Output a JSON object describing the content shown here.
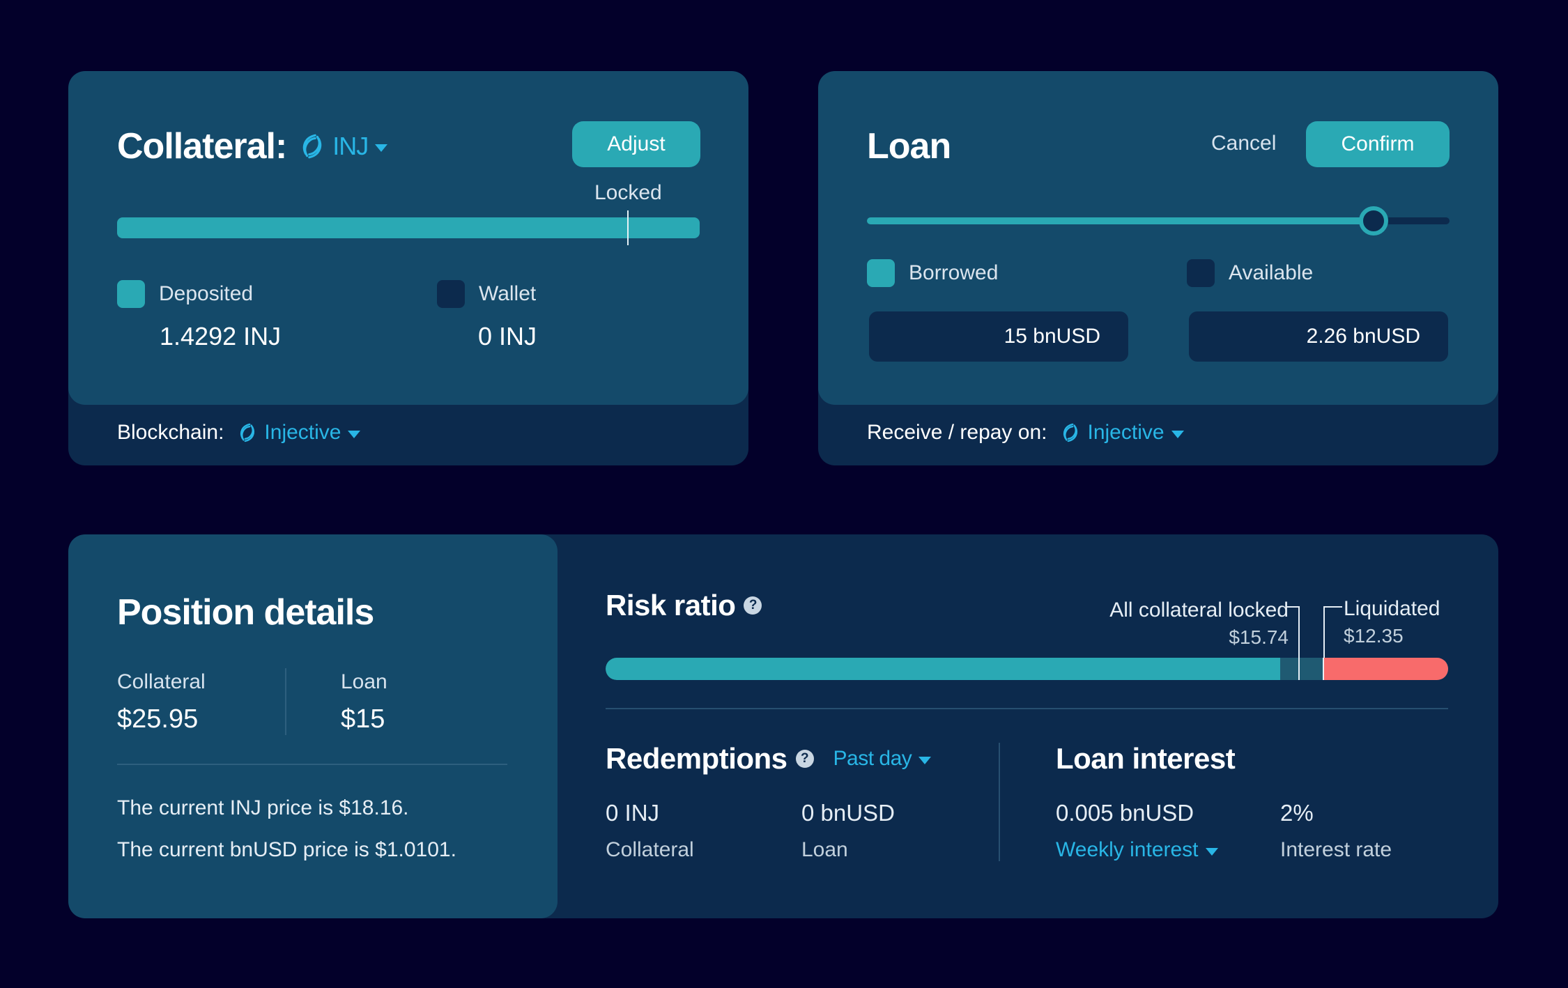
{
  "collateral": {
    "title": "Collateral:",
    "asset": "INJ",
    "adjust_label": "Adjust",
    "locked_label": "Locked",
    "locked_fraction": 0.876,
    "legend": [
      {
        "label": "Deposited",
        "value": "1.4292 INJ"
      },
      {
        "label": "Wallet",
        "value": "0 INJ"
      }
    ],
    "footer_label": "Blockchain:",
    "chain": "Injective"
  },
  "loan": {
    "title": "Loan",
    "cancel_label": "Cancel",
    "confirm_label": "Confirm",
    "slider_fraction": 0.87,
    "legend": [
      {
        "label": "Borrowed",
        "value": "15 bnUSD"
      },
      {
        "label": "Available",
        "value": "2.26 bnUSD"
      }
    ],
    "footer_label": "Receive / repay on:",
    "chain": "Injective"
  },
  "position": {
    "title": "Position details",
    "collateral_label": "Collateral",
    "collateral_value": "$25.95",
    "loan_label": "Loan",
    "loan_value": "$15",
    "price_lines": [
      "The current INJ price is $18.16.",
      "The current bnUSD price is $1.0101."
    ]
  },
  "risk": {
    "title": "Risk ratio",
    "help": "?",
    "locked_label": "All collateral locked",
    "locked_value": "$15.74",
    "liquidated_label": "Liquidated",
    "liquidated_value": "$12.35",
    "fill_fraction": 0.801
  },
  "redemptions": {
    "title": "Redemptions",
    "help": "?",
    "period": "Past day",
    "collateral_value": "0 INJ",
    "collateral_label": "Collateral",
    "loan_value": "0 bnUSD",
    "loan_label": "Loan"
  },
  "interest": {
    "title": "Loan interest",
    "amount": "0.005 bnUSD",
    "period": "Weekly interest",
    "rate": "2%",
    "rate_label": "Interest rate"
  },
  "colors": {
    "background": "#03002a",
    "card": "#144a6a",
    "card_dark": "#0c2a4d",
    "accent": "#2aa9b4",
    "link": "#29b6e6",
    "danger": "#f86b6b"
  }
}
